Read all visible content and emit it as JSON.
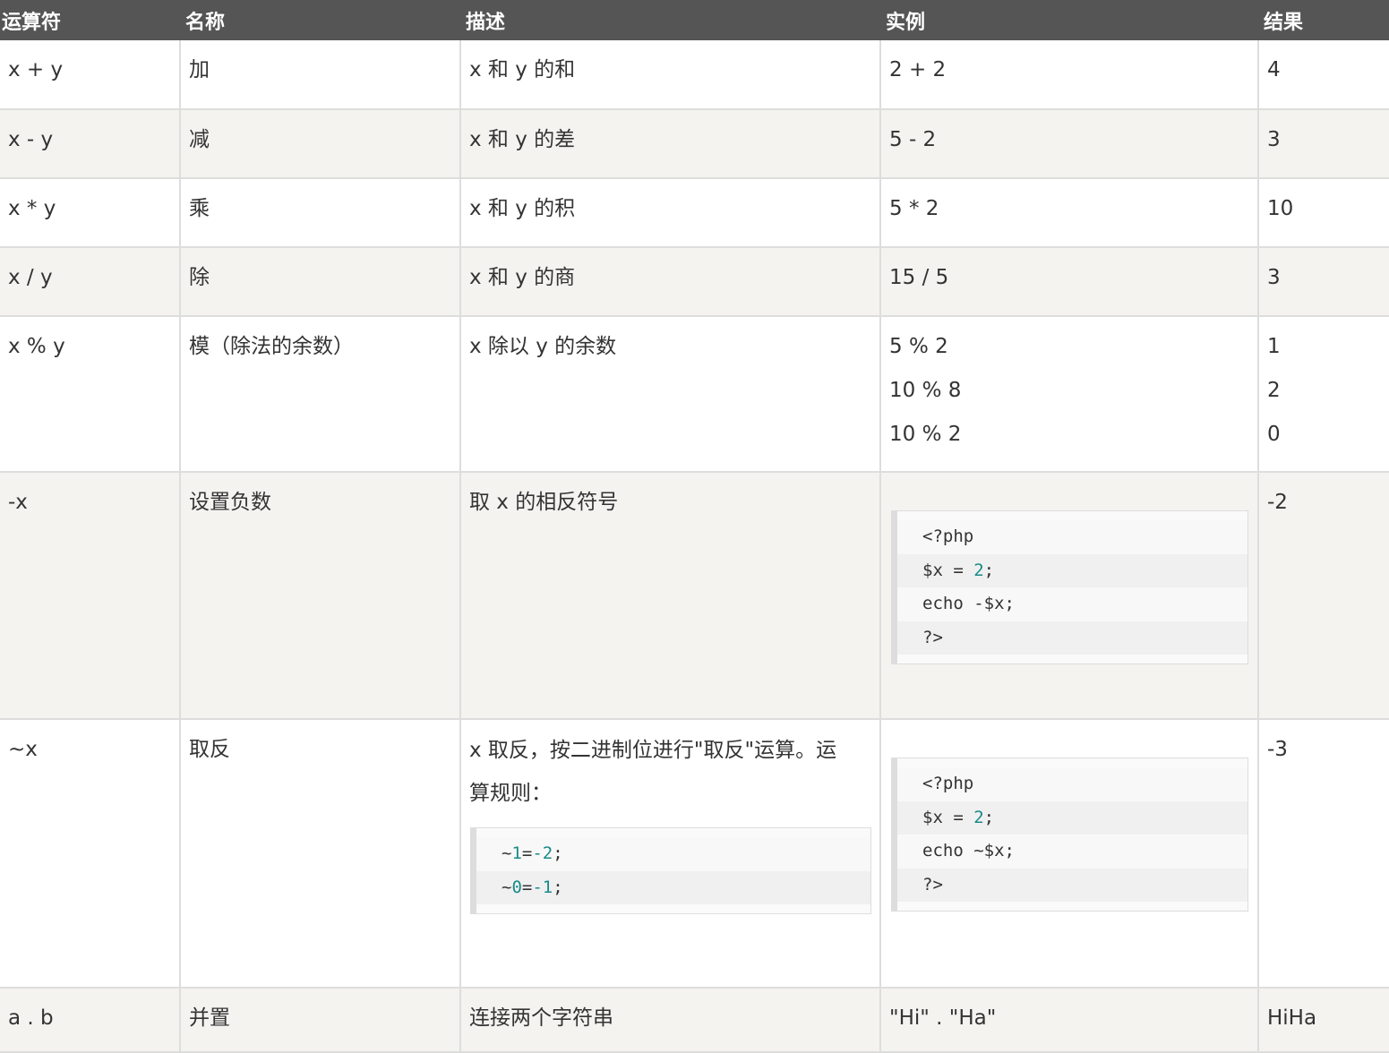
{
  "header": {
    "col_operator": "运算符",
    "col_name": "名称",
    "col_desc": "描述",
    "col_example": "实例",
    "col_result": "结果"
  },
  "rows": [
    {
      "operator": "x + y",
      "name": "加",
      "desc": "x 和 y 的和",
      "example": "2 + 2",
      "result": "4"
    },
    {
      "operator": "x - y",
      "name": "减",
      "desc": "x 和 y 的差",
      "example": "5 - 2",
      "result": "3"
    },
    {
      "operator": "x * y",
      "name": "乘",
      "desc": "x 和 y 的积",
      "example": "5 * 2",
      "result": "10"
    },
    {
      "operator": "x / y",
      "name": "除",
      "desc": "x 和 y 的商",
      "example": "15 / 5",
      "result": "3"
    },
    {
      "operator": "x % y",
      "name": "模（除法的余数）",
      "desc": "x 除以 y 的余数",
      "examples": [
        "5 % 2",
        "10 % 8",
        "10 % 2"
      ],
      "results": [
        "1",
        "2",
        "0"
      ]
    },
    {
      "operator": "-x",
      "name": "设置负数",
      "desc": "取 x 的相反符号",
      "code": [
        "<?php",
        "$x = 2;",
        "echo -$x;",
        "?>"
      ],
      "result": "-2"
    },
    {
      "operator": "~x",
      "name": "取反",
      "desc_lines": [
        "x 取反，按二进制位进行\"取反\"运算。运",
        "算规则："
      ],
      "desc_code": [
        "~1=-2;",
        "~0=-1;"
      ],
      "code": [
        "<?php",
        "$x = 2;",
        "echo ~$x;",
        "?>"
      ],
      "result": "-3"
    },
    {
      "operator": "a . b",
      "name": "并置",
      "desc": "连接两个字符串",
      "example": "\"Hi\" . \"Ha\"",
      "result": "HiHa"
    }
  ]
}
